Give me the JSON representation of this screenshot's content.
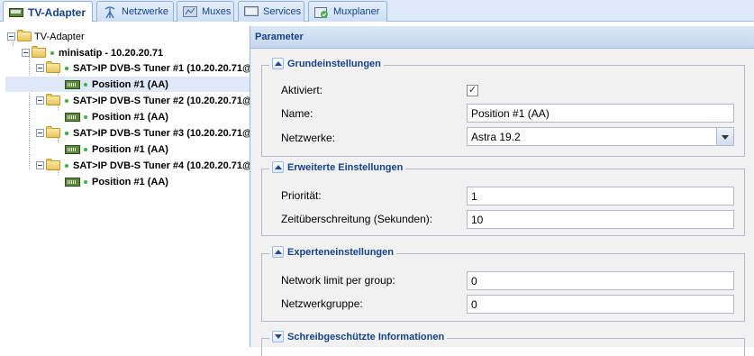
{
  "tabs": [
    {
      "label": "TV-Adapter",
      "icon": "tv-card-icon",
      "active": true
    },
    {
      "label": "Netzwerke",
      "icon": "antenna-icon",
      "active": false
    },
    {
      "label": "Muxes",
      "icon": "mux-icon",
      "active": false
    },
    {
      "label": "Services",
      "icon": "services-icon",
      "active": false
    },
    {
      "label": "Muxplaner",
      "icon": "scheduler-icon",
      "active": false
    }
  ],
  "tree": {
    "root": "TV-Adapter",
    "device": "minisatip - 10.20.20.71",
    "tuners": [
      {
        "label": "SAT>IP DVB-S Tuner #1 (10.20.20.71@",
        "position": "Position #1 (AA)"
      },
      {
        "label": "SAT>IP DVB-S Tuner #2 (10.20.20.71@",
        "position": "Position #1 (AA)"
      },
      {
        "label": "SAT>IP DVB-S Tuner #3 (10.20.20.71@",
        "position": "Position #1 (AA)"
      },
      {
        "label": "SAT>IP DVB-S Tuner #4 (10.20.20.71@",
        "position": "Position #1 (AA)"
      }
    ]
  },
  "panel": {
    "title": "Parameter",
    "basic": {
      "legend": "Grundeinstellungen",
      "enabled_label": "Aktiviert:",
      "enabled": true,
      "name_label": "Name:",
      "name_value": "Position #1 (AA)",
      "networks_label": "Netzwerke:",
      "networks_value": "Astra 19.2"
    },
    "advanced": {
      "legend": "Erweiterte Einstellungen",
      "priority_label": "Priorität:",
      "priority_value": "1",
      "timeout_label": "Zeitüberschreitung (Sekunden):",
      "timeout_value": "10"
    },
    "expert": {
      "legend": "Experteneinstellungen",
      "netlimit_label": "Network limit per group:",
      "netlimit_value": "0",
      "netgroup_label": "Netzwerkgruppe:",
      "netgroup_value": "0"
    },
    "readonly": {
      "legend": "Schreibgeschützte Informationen"
    }
  }
}
